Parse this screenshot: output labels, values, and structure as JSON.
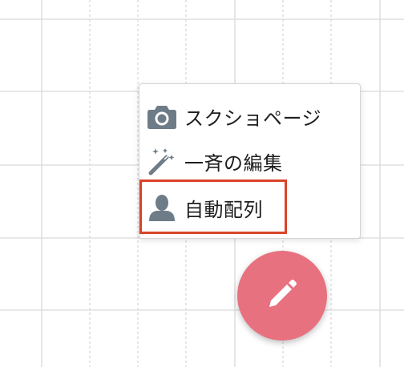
{
  "menu": {
    "items": [
      {
        "icon": "camera-icon",
        "label": "スクショページ"
      },
      {
        "icon": "magic-wand-icon",
        "label": "一斉の編集"
      },
      {
        "icon": "person-icon",
        "label": "自動配列"
      }
    ],
    "highlighted_item": "自動配列"
  },
  "fab": {
    "icon": "pencil-icon"
  },
  "colors": {
    "fab_background": "#e8717f",
    "highlight_border": "#d9442a",
    "icon_gray": "#6e7c87",
    "grid_line": "#d9d9d9"
  }
}
